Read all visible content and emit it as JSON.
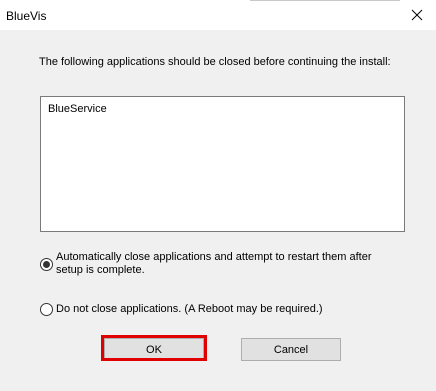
{
  "window": {
    "title": "BlueVis",
    "close_glyph": "close-icon"
  },
  "message": "The following applications should be closed before continuing the install:",
  "applications": [
    "BlueService"
  ],
  "options": [
    {
      "label": "Automatically close applications and attempt to restart them after setup is complete.",
      "checked": true
    },
    {
      "label": "Do not close applications. (A Reboot may be required.)",
      "checked": false
    }
  ],
  "buttons": {
    "ok_label": "OK",
    "cancel_label": "Cancel"
  },
  "colors": {
    "highlight": "#e00000",
    "window_bg": "#f0f0f0",
    "titlebar_bg": "#ffffff"
  }
}
